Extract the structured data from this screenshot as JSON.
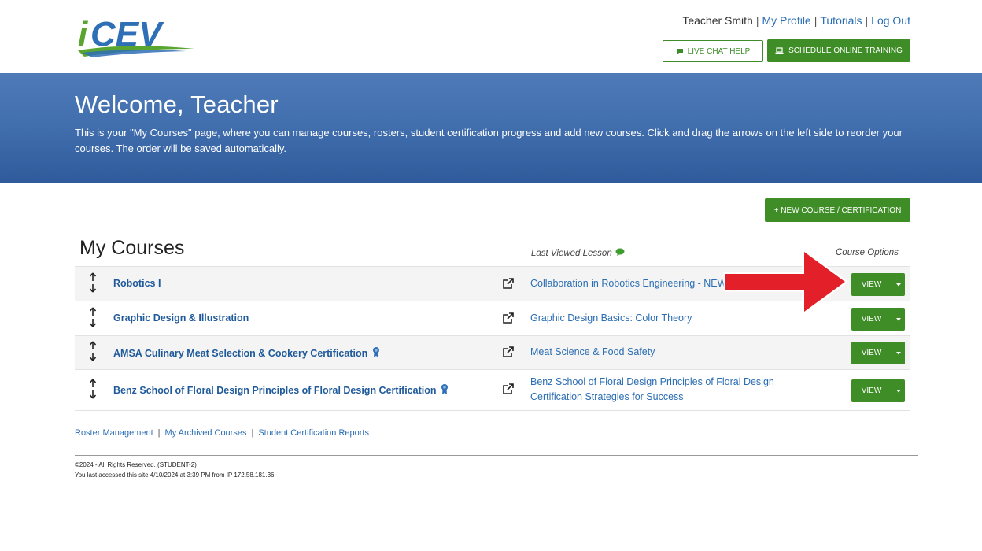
{
  "header": {
    "logo_text": "iCEV",
    "user_name": "Teacher Smith",
    "links": [
      "My Profile",
      "Tutorials",
      "Log Out"
    ],
    "separator": "|",
    "live_chat_label": "LIVE CHAT HELP",
    "schedule_training_label": "SCHEDULE ONLINE TRAINING"
  },
  "banner": {
    "title": "Welcome, Teacher",
    "description": "This is your \"My Courses\" page, where you can manage courses, rosters, student certification progress and add new courses. Click and drag the arrows on the left side to reorder your courses. The order will be saved automatically."
  },
  "actions": {
    "new_course_label": "+ NEW COURSE / CERTIFICATION"
  },
  "courses": {
    "title": "My Courses",
    "last_viewed_header": "Last Viewed Lesson",
    "options_header": "Course Options",
    "view_label": "VIEW",
    "rows": [
      {
        "name": "Robotics I",
        "lesson": "Collaboration in Robotics Engineering - NEW",
        "certification": false
      },
      {
        "name": "Graphic Design & Illustration",
        "lesson": "Graphic Design Basics: Color Theory",
        "certification": false
      },
      {
        "name": "AMSA Culinary Meat Selection & Cookery Certification",
        "lesson": "Meat Science & Food Safety",
        "certification": true
      },
      {
        "name": "Benz School of Floral Design Principles of Floral Design Certification",
        "lesson": "Benz School of Floral Design Principles of Floral Design Certification Strategies for Success",
        "certification": true
      }
    ]
  },
  "footer": {
    "links": [
      "Roster Management",
      "My Archived Courses",
      "Student Certification Reports"
    ],
    "copyright": "©2024 - All Rights Reserved. (STUDENT-2)",
    "last_access": "You last accessed this site 4/10/2024 at 3:39 PM from IP 172.58.181.36."
  },
  "colors": {
    "brand_green": "#3f8d27",
    "brand_blue": "#426fae",
    "link_blue": "#2a6db3",
    "annotation_red": "#e3202a"
  },
  "icons": [
    "chat-icon",
    "laptop-icon",
    "arrow-up-icon",
    "arrow-down-icon",
    "external-link-icon",
    "ribbon-icon",
    "caret-down-icon"
  ]
}
